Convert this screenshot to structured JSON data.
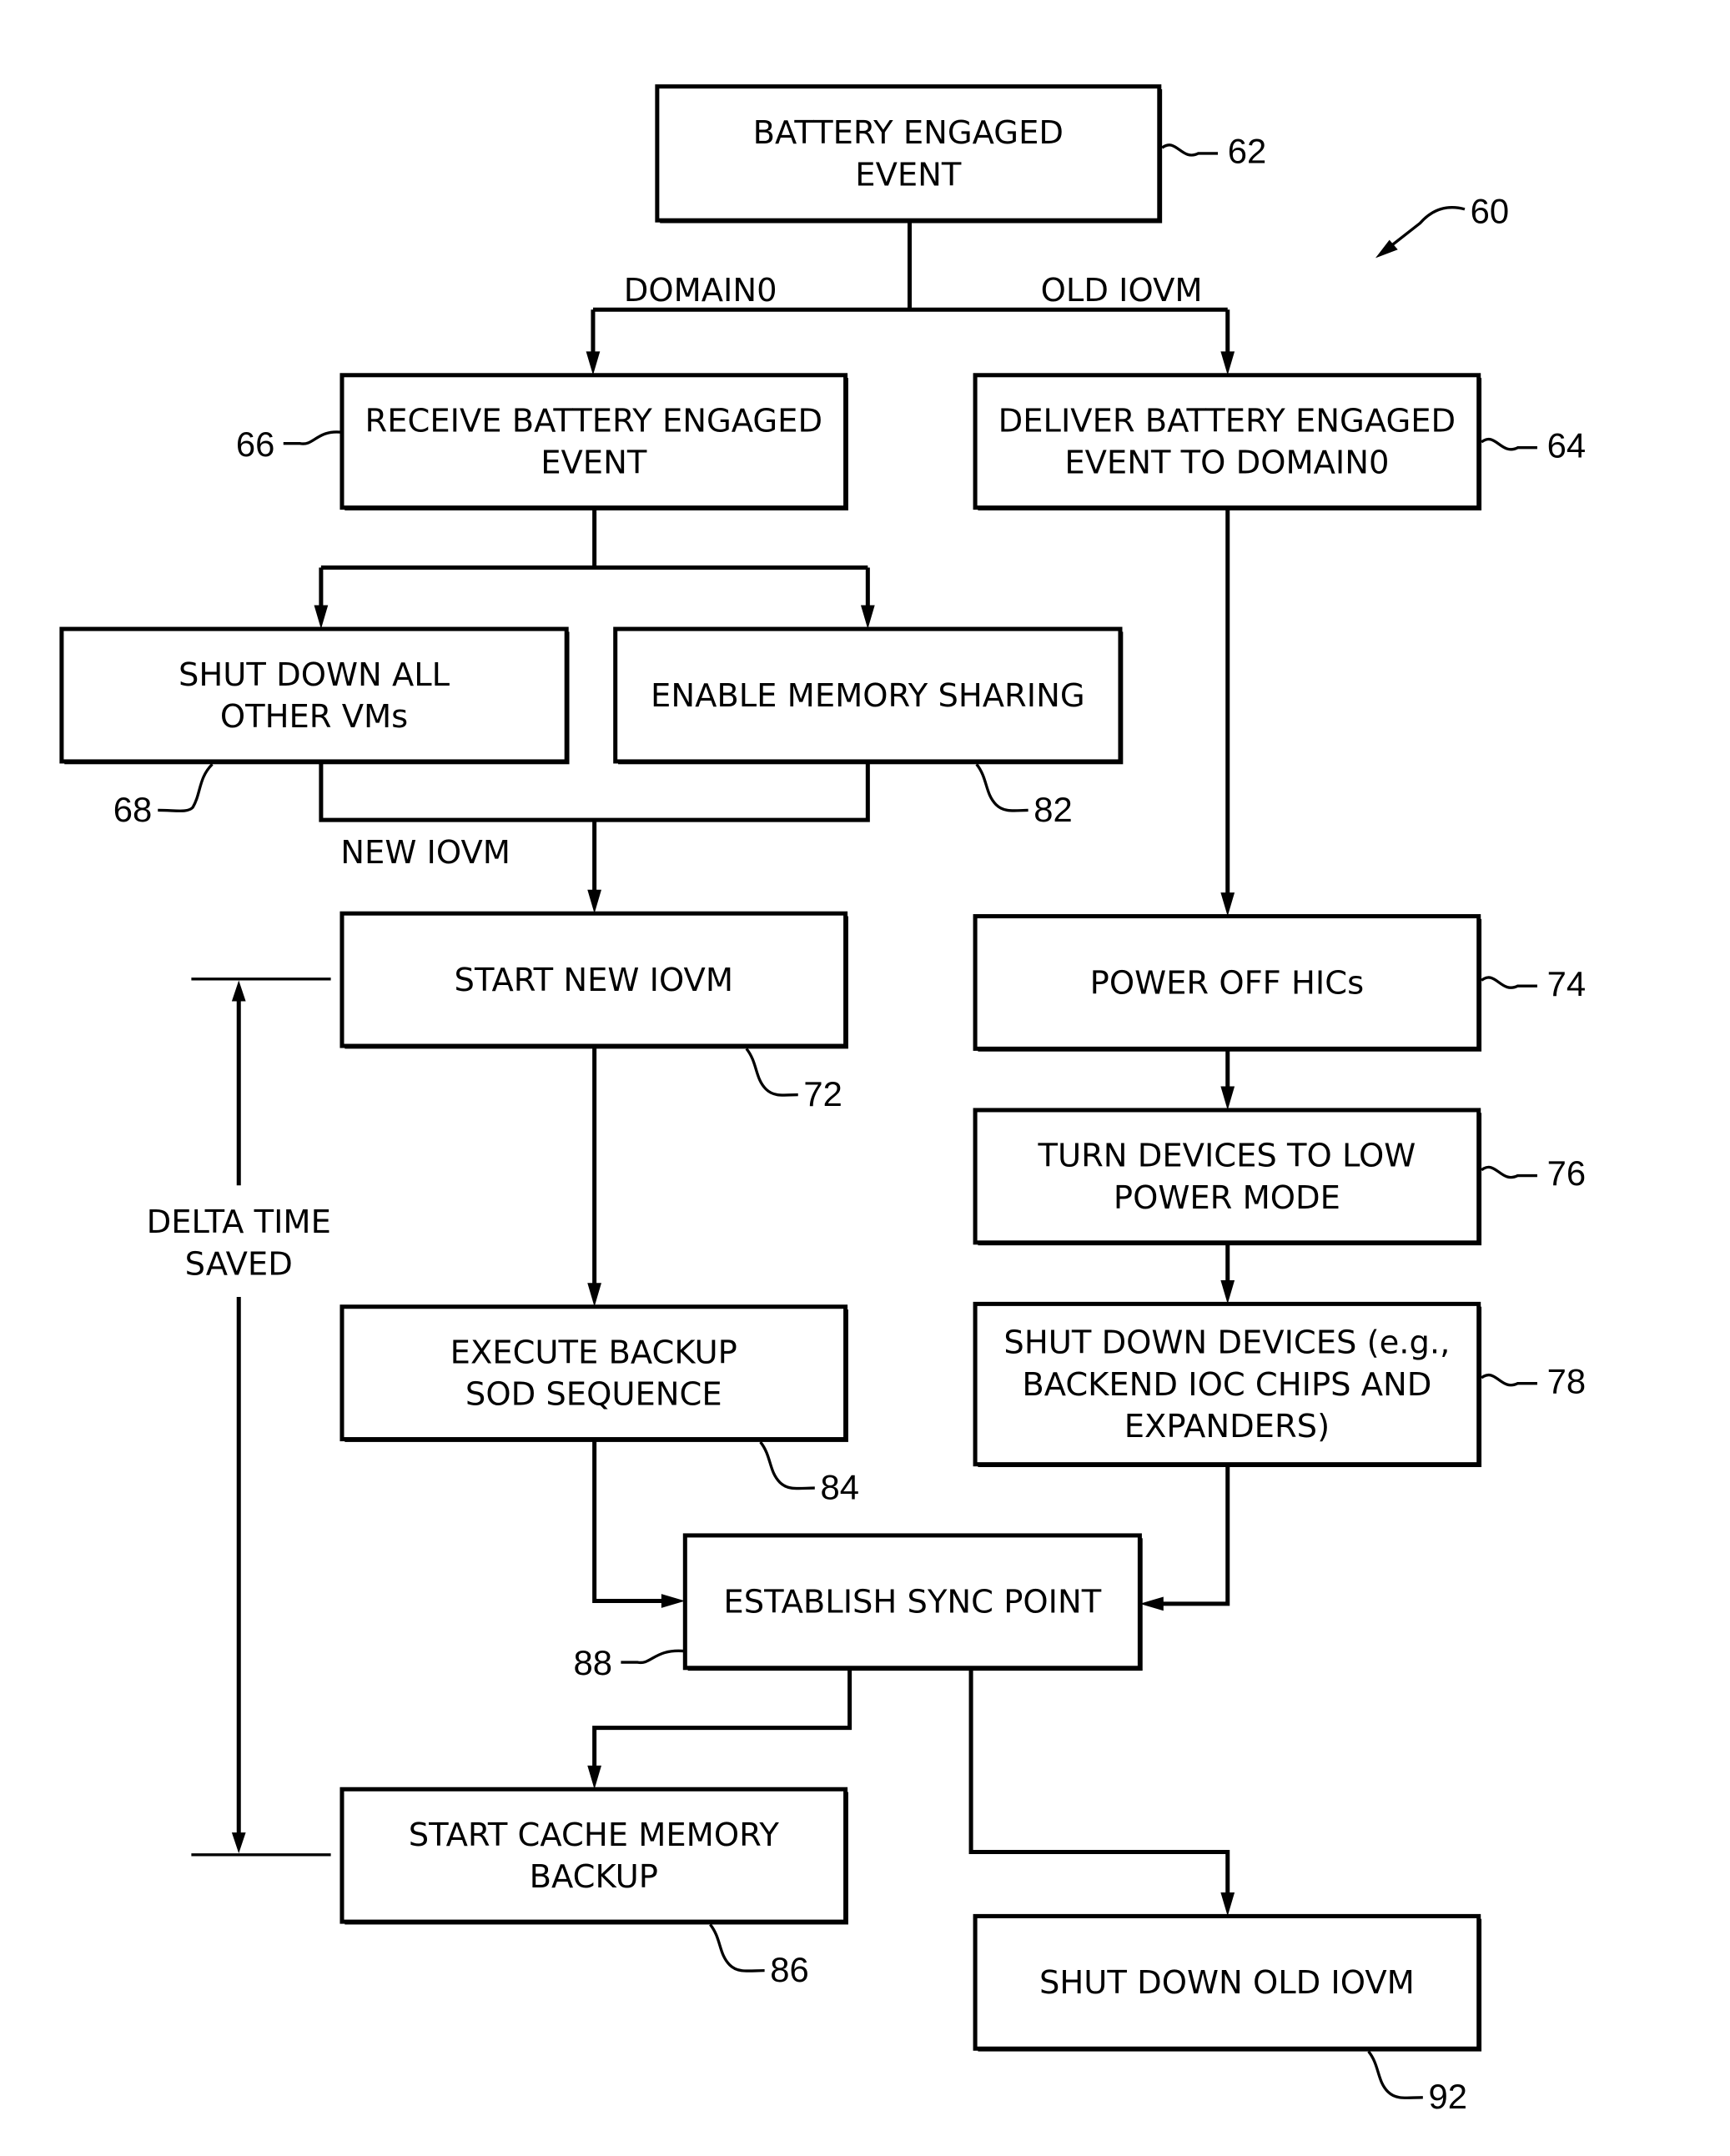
{
  "figure": {
    "reference": "60",
    "boxes": [
      {
        "id": "62",
        "lines": [
          "BATTERY ENGAGED",
          "EVENT"
        ]
      },
      {
        "id": "66",
        "lines": [
          "RECEIVE BATTERY ENGAGED",
          "EVENT"
        ]
      },
      {
        "id": "64",
        "lines": [
          "DELIVER BATTERY ENGAGED",
          "EVENT TO DOMAIN0"
        ]
      },
      {
        "id": "68",
        "lines": [
          "SHUT DOWN ALL",
          "OTHER VMs"
        ]
      },
      {
        "id": "82",
        "lines": [
          "ENABLE MEMORY SHARING"
        ]
      },
      {
        "id": "72",
        "lines": [
          "START NEW IOVM"
        ]
      },
      {
        "id": "74",
        "lines": [
          "POWER OFF HICs"
        ]
      },
      {
        "id": "76",
        "lines": [
          "TURN DEVICES TO LOW",
          "POWER MODE"
        ]
      },
      {
        "id": "78",
        "lines": [
          "SHUT DOWN DEVICES (e.g.,",
          "BACKEND IOC CHIPS AND",
          "EXPANDERS)"
        ]
      },
      {
        "id": "84",
        "lines": [
          "EXECUTE BACKUP",
          "SOD SEQUENCE"
        ]
      },
      {
        "id": "88",
        "lines": [
          "ESTABLISH SYNC POINT"
        ]
      },
      {
        "id": "86",
        "lines": [
          "START CACHE MEMORY",
          "BACKUP"
        ]
      },
      {
        "id": "92",
        "lines": [
          "SHUT DOWN OLD IOVM"
        ]
      }
    ],
    "branch_labels": {
      "domain0": "DOMAIN0",
      "old_iovm": "OLD IOVM",
      "new_iovm": "NEW IOVM"
    },
    "delta": {
      "line1": "DELTA TIME",
      "line2": "SAVED"
    }
  }
}
